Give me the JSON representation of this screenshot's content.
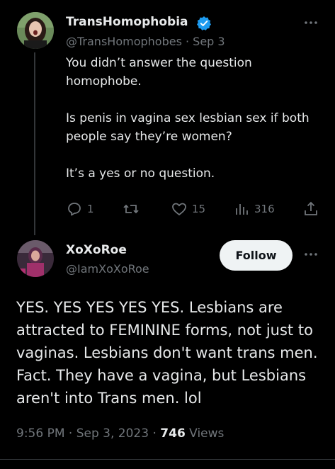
{
  "colors": {
    "background": "#000000",
    "text_primary": "#e7e9ea",
    "text_secondary": "#71767b",
    "verified_blue": "#1d9bf0",
    "follow_bg": "#eff3f4",
    "follow_text": "#0f1419"
  },
  "reply_tweet": {
    "author_name": "TransHomophobia",
    "verified": true,
    "handle": "@TransHomophobes",
    "separator": " · ",
    "date": "Sep 3",
    "text_lines": [
      "You didn’t answer the question homophobe.",
      "Is penis in vagina sex lesbian sex if both people say they’re women?",
      "It’s a yes or no question."
    ],
    "actions": {
      "replies": "1",
      "retweets": "",
      "likes": "15",
      "views": "316"
    }
  },
  "main_tweet": {
    "author_name": "XoXoRoe",
    "handle": "@IamXoXoRoe",
    "follow_label": "Follow",
    "text": "YES.  YES YES YES YES. Lesbians are attracted to FEMININE forms, not just to vaginas.  Lesbians don't want trans men. Fact.  They have a vagina, but Lesbians aren't into Trans men.  lol",
    "time": "9:56 PM",
    "dot": " · ",
    "date": "Sep 3, 2023",
    "views_count": "746",
    "views_label": " Views"
  }
}
